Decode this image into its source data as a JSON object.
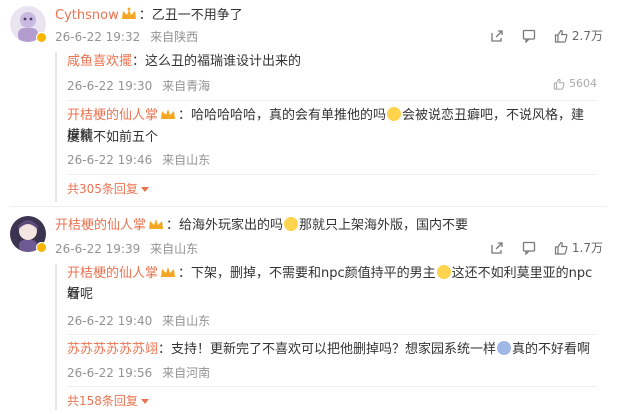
{
  "thread1": {
    "user": "Cythsnow",
    "text": "：乙丑一不用争了",
    "date": "26-6-22 19:32",
    "loc": "来自陕西",
    "likes": "2.7万",
    "replies": [
      {
        "user": "咸鱼喜欢擺",
        "text": "：这么丑的福瑞谁设计出来的",
        "date": "26-6-22 19:30",
        "loc": "来自青海",
        "likes": "5604"
      },
      {
        "user": "开桔梗的仙人掌",
        "text1": "：哈哈哈哈哈，真的会有单推他的吗",
        "text2": "会被说恋丑癖吧，不说风格，建模精",
        "text3": "度就不如前五个",
        "date": "26-6-22 19:46",
        "loc": "来自山东"
      }
    ],
    "more": "共305条回复"
  },
  "thread2": {
    "user": "开桔梗的仙人掌",
    "text1": "：给海外玩家出的吗",
    "text2": "那就只上架海外版，国内不要",
    "date": "26-6-22 19:39",
    "loc": "来自山东",
    "likes": "1.7万",
    "replies": [
      {
        "user": "开桔梗的仙人掌",
        "text1": "：下架，删掉，不需要和npc颜值持平的男主",
        "text2": "这还不如利莫里亚的npc好",
        "text3": "看呢",
        "date": "26-6-22 19:40",
        "loc": "来自山东"
      },
      {
        "user": "苏苏苏苏苏苏翊",
        "text1": "：支持！更新完了不喜欢可以把他删掉吗？想家园系统一样",
        "text2": "真的不好看啊",
        "date": "26-6-22 19:56",
        "loc": "来自河南"
      }
    ],
    "more": "共158条回复"
  },
  "icons": [
    "share-icon",
    "comment-icon",
    "like-icon",
    "crown-badge-icon",
    "verified-icon",
    "emoji-icon"
  ],
  "colors": {
    "username": "#eb7350",
    "meta": "#939393",
    "text": "#333333"
  }
}
